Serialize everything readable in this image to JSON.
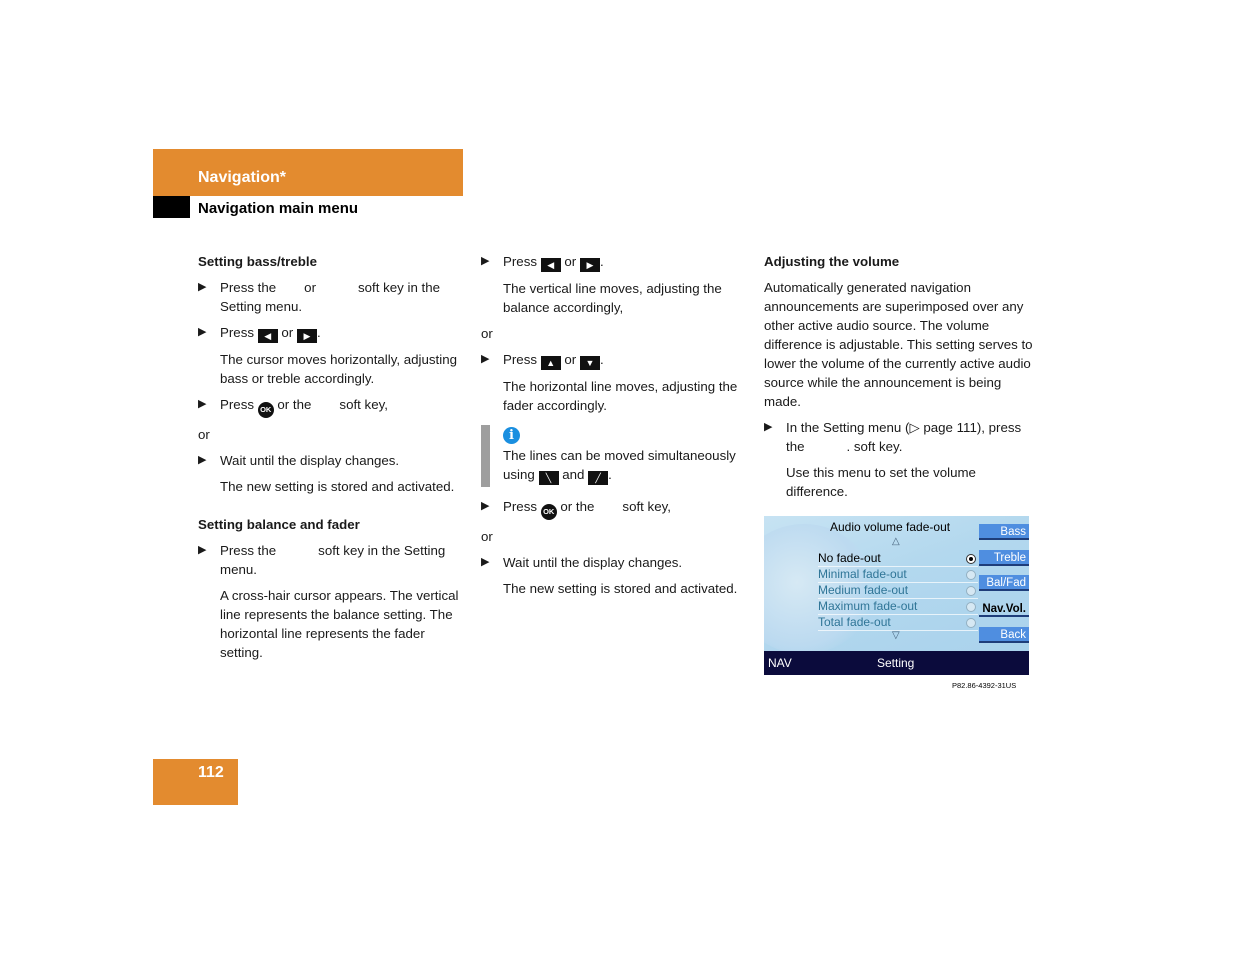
{
  "header": {
    "title": "Navigation*",
    "subtitle": "Navigation main menu",
    "accent_color": "#e38b2f"
  },
  "col1": {
    "heading1": "Setting bass/treble",
    "s1": "Press the",
    "s1_or": "or",
    "s1_tail": "soft key in the Setting menu.",
    "s2_press": "Press",
    "s2_or": "or",
    "p1": "The cursor moves horizontally, adjusting bass or treble accordingly.",
    "s3_press": "Press",
    "s3_tail": "or the",
    "s3_end": "soft key,",
    "or": "or",
    "s4": "Wait until the display changes.",
    "p2": "The new setting is stored and activated.",
    "heading2": "Setting balance and fader",
    "s5": "Press the",
    "s5_tail": "soft key in the Setting menu.",
    "p3": "A cross-hair cursor appears. The vertical line represents the balance setting. The horizontal line represents the fader setting."
  },
  "col2": {
    "s1_press": "Press",
    "s1_or": "or",
    "p1": "The vertical line moves, adjusting the balance accordingly,",
    "or": "or",
    "s2_press": "Press",
    "s2_or": "or",
    "p2": "The horizontal line moves, adjusting the fader accordingly.",
    "info_text": "The lines can be moved simultaneously using",
    "info_and": "and",
    "s3_press": "Press",
    "s3_tail": "or the",
    "s3_end": "soft key,",
    "or2": "or",
    "s4": "Wait until the display changes.",
    "p3": "The new setting is stored and activated."
  },
  "col3": {
    "heading": "Adjusting the volume",
    "p1": "Automatically generated navigation announcements are superimposed over any other active audio source. The volume difference is adjustable. This setting serves to lower the volume of the currently active audio source while the announcement is being made.",
    "s1": "In the Setting menu (▷ page 111), press the",
    "s1_end": ". soft key.",
    "p2": "Use this menu to set the volume difference."
  },
  "keys": {
    "left": "◀",
    "right": "▶",
    "up": "▲",
    "down": "▼",
    "diag_down": "╲",
    "diag_up": "╱",
    "ok": "OK",
    "bullet": "▶"
  },
  "screen": {
    "title": "Audio volume fade-out",
    "scroll_up": "△",
    "scroll_down": "▽",
    "options": [
      {
        "label": "No fade-out",
        "selected": true
      },
      {
        "label": "Minimal fade-out",
        "selected": false
      },
      {
        "label": "Medium fade-out",
        "selected": false
      },
      {
        "label": "Maximum fade-out",
        "selected": false
      },
      {
        "label": "Total fade-out",
        "selected": false
      }
    ],
    "softkeys": [
      "Bass",
      "Treble",
      "Bal/Fad",
      "Nav.Vol.",
      "Back"
    ],
    "footer_left": "NAV",
    "footer_center": "Setting",
    "caption": "P82.86-4392-31US"
  },
  "page_number": "112"
}
